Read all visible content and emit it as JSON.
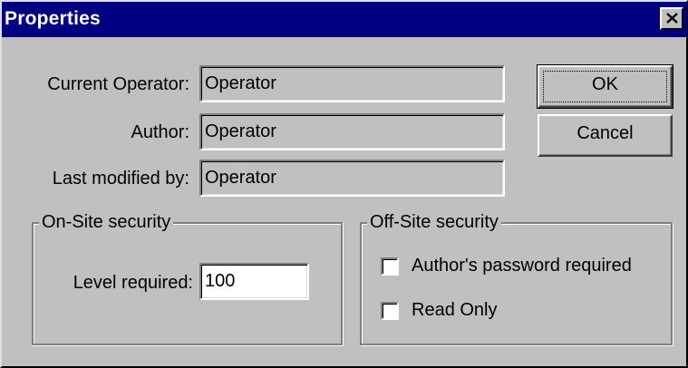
{
  "window": {
    "title": "Properties"
  },
  "fields": {
    "current_operator": {
      "label": "Current Operator:",
      "value": "Operator"
    },
    "author": {
      "label": "Author:",
      "value": "Operator"
    },
    "last_modified_by": {
      "label": "Last modified by:",
      "value": "Operator"
    }
  },
  "buttons": {
    "ok": "OK",
    "cancel": "Cancel"
  },
  "onsite": {
    "title": "On-Site security",
    "level_label": "Level required:",
    "level_value": "100"
  },
  "offsite": {
    "title": "Off-Site security",
    "authors_password": {
      "label": "Author's password required",
      "checked": false
    },
    "read_only": {
      "label": "Read Only",
      "checked": false
    }
  },
  "colors": {
    "titlebar": "#000080",
    "face": "#c0c0c0"
  }
}
